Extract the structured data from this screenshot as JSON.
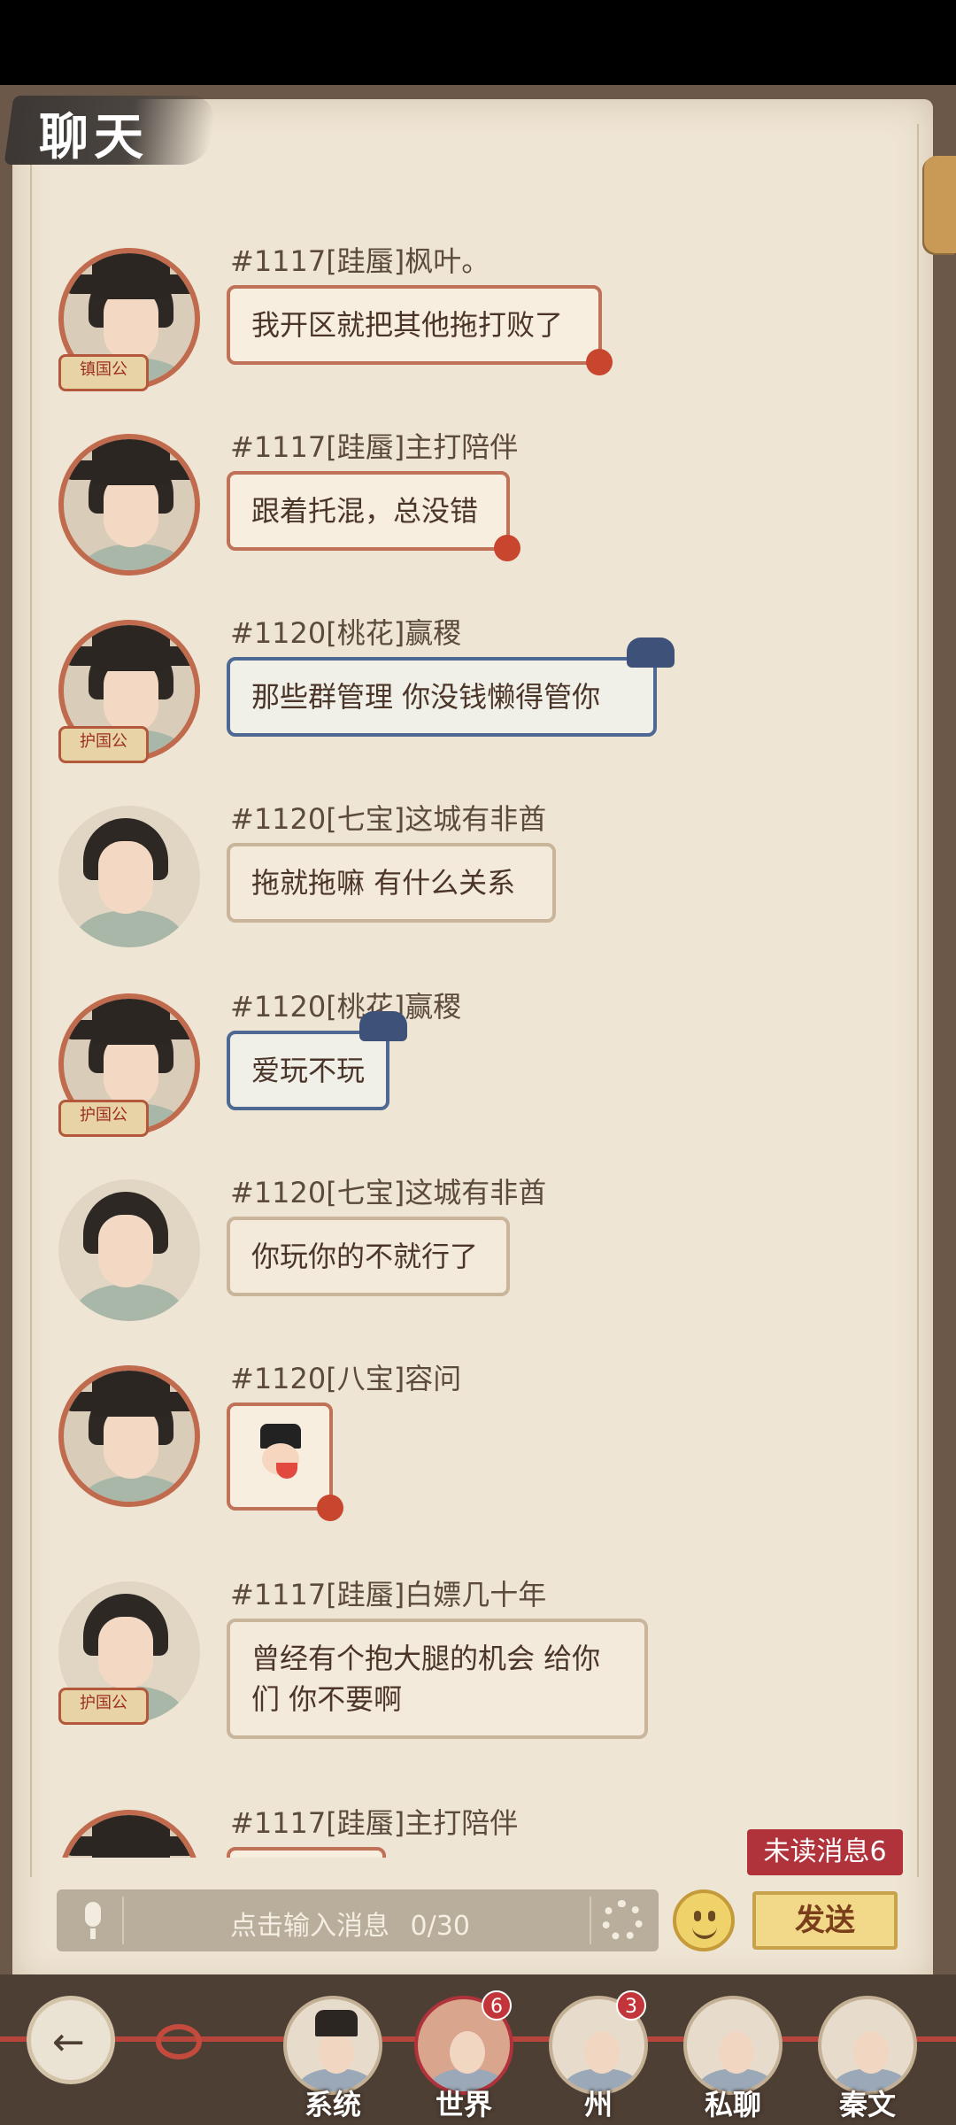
{
  "header": {
    "title": "聊天"
  },
  "messages": [
    {
      "sender": "#1117[跬蜃]枫叶。",
      "text": "我开区就把其他拖打败了",
      "style": "red",
      "badge": "镇国公"
    },
    {
      "sender": "#1117[跬蜃]主打陪伴",
      "text": "跟着托混，总没错",
      "style": "red",
      "badge": ""
    },
    {
      "sender": "#1120[桃花]赢稷",
      "text": "那些群管理 你没钱懒得管你",
      "style": "blue",
      "badge": "护国公"
    },
    {
      "sender": "#1120[七宝]这城有非酋",
      "text": "拖就拖嘛 有什么关系",
      "style": "plain",
      "badge": ""
    },
    {
      "sender": "#1120[桃花]赢稷",
      "text": "爱玩不玩",
      "style": "blue",
      "badge": "护国公"
    },
    {
      "sender": "#1120[七宝]这城有非酋",
      "text": "你玩你的不就行了",
      "style": "plain",
      "badge": ""
    },
    {
      "sender": "#1120[八宝]容问",
      "text": "",
      "style": "red",
      "badge": "",
      "sticker": "official-sticker"
    },
    {
      "sender": "#1117[跬蜃]白嫖几十年",
      "text_line1": "曾经有个抱大腿的机会 给你",
      "text_line2": "们 你不要啊",
      "style": "plain",
      "badge": "护国公"
    },
    {
      "sender": "#1117[跬蜃]主打陪伴",
      "text": "",
      "style": "red",
      "badge": ""
    }
  ],
  "input": {
    "placeholder": "点击输入消息",
    "counter": "0/30"
  },
  "unread": "未读消息6",
  "send_label": "发送",
  "tabs": [
    {
      "label": "系统",
      "count": ""
    },
    {
      "label": "世界",
      "count": "6"
    },
    {
      "label": "州",
      "count": "3"
    },
    {
      "label": "私聊",
      "count": ""
    },
    {
      "label": "秦文",
      "count": ""
    }
  ],
  "colors": {
    "paper": "#efe5d4",
    "bubble_red_border": "#c07258",
    "bubble_blue_border": "#4d6893",
    "unread_bg": "#b0333c"
  }
}
